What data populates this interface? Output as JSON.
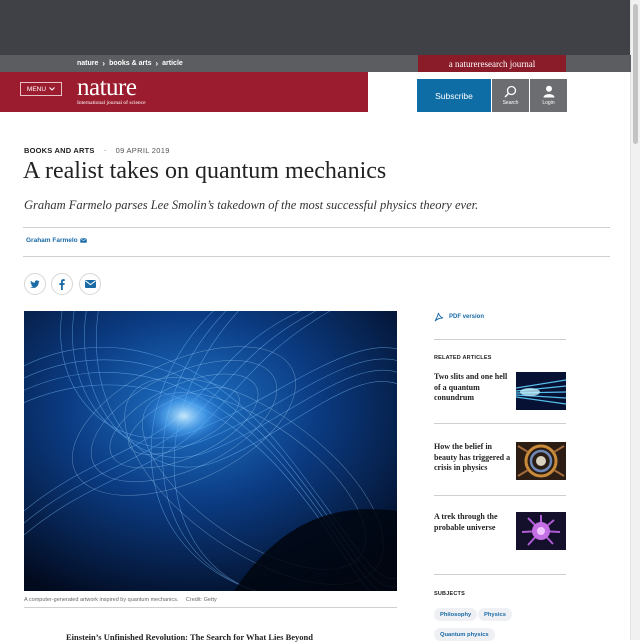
{
  "breadcrumb": {
    "items": [
      "nature",
      "books & arts",
      "article"
    ],
    "separator": "›"
  },
  "journal_tag": "a natureresearch journal",
  "header": {
    "menu_label": "MENU",
    "logo": {
      "word": "nature",
      "tagline": "International journal of science"
    },
    "subscribe_label": "Subscribe",
    "search_label": "Search",
    "login_label": "Login"
  },
  "article": {
    "section": "BOOKS AND ARTS",
    "separator": "·",
    "date": "09 APRIL 2019",
    "title": "A realist takes on quantum mechanics",
    "standfirst": "Graham Farmelo parses Lee Smolin’s takedown of the most successful physics theory ever.",
    "author": "Graham Farmelo",
    "image_caption": "A computer-generated artwork inspired by quantum mechanics.",
    "image_credit": "Credit: Getty",
    "book_title": "Einstein’s Unfinished Revolution: The Search for What Lies Beyond"
  },
  "sidebar": {
    "pdf_label": "PDF version",
    "related_heading": "RELATED ARTICLES",
    "related": [
      {
        "title": "Two slits and one hell of a quantum conundrum"
      },
      {
        "title": "How the belief in beauty has triggered a crisis in physics"
      },
      {
        "title": "A trek through the probable universe"
      }
    ],
    "subjects_heading": "SUBJECTS",
    "subjects": [
      "Philosophy",
      "Physics",
      "Quantum physics"
    ]
  },
  "colors": {
    "brand_red": "#9b1c2e",
    "subscribe_blue": "#0f6da6",
    "link_blue": "#1a6aa6",
    "header_dark": "#3f4147"
  }
}
